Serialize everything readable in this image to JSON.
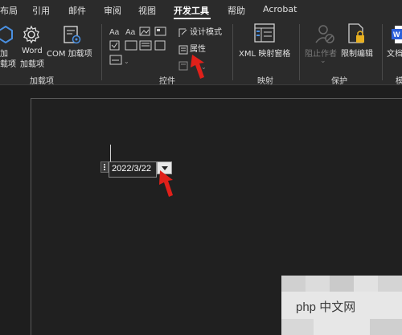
{
  "tabs": [
    "布局",
    "引用",
    "邮件",
    "审阅",
    "视图",
    "开发工具",
    "帮助",
    "Acrobat"
  ],
  "active_tab": "开发工具",
  "addins": {
    "addin_label": [
      "加",
      "载项"
    ],
    "word_addin_label": [
      "Word",
      "加载项"
    ],
    "com_addin_label": "COM 加载项",
    "group_label": "加载项"
  },
  "controls": {
    "design_mode_label": "设计模式",
    "properties_label": "属性",
    "group_label": "控件"
  },
  "mapping": {
    "xml_pane_label": "XML 映射窗格",
    "group_label": "映射"
  },
  "protection": {
    "block_authors_label": "阻止作者",
    "restrict_editing_label": "限制编辑",
    "group_label": "保护"
  },
  "templates": {
    "doc_template_label": "文档",
    "group_label": "模"
  },
  "document": {
    "date_value": "2022/3/22"
  },
  "watermark": {
    "text": "php 中文网"
  },
  "colors": {
    "ribbon_bg": "#2b2b2b",
    "doc_bg": "#1e1e1e",
    "arrow_red": "#e0201a",
    "word_blue": "#2b5fd9"
  }
}
